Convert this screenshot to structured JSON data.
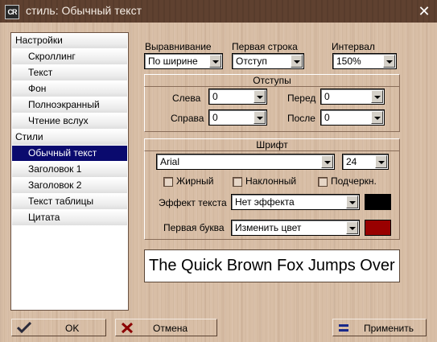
{
  "window": {
    "title": "стиль: Обычный текст",
    "icon_text": "CR"
  },
  "colors": {
    "title_bar": "#5f4130",
    "selection": "#0a0a6e",
    "text_effect_color": "#000000",
    "first_letter_color": "#990000"
  },
  "sidebar": {
    "items": [
      {
        "label": "Настройки",
        "kind": "section"
      },
      {
        "label": "Скроллинг",
        "kind": "item"
      },
      {
        "label": "Текст",
        "kind": "item"
      },
      {
        "label": "Фон",
        "kind": "item"
      },
      {
        "label": "Полноэкранный",
        "kind": "item"
      },
      {
        "label": "Чтение вслух",
        "kind": "item"
      },
      {
        "label": "Стили",
        "kind": "section"
      },
      {
        "label": "Обычный текст",
        "kind": "item",
        "selected": true
      },
      {
        "label": "Заголовок 1",
        "kind": "item"
      },
      {
        "label": "Заголовок 2",
        "kind": "item"
      },
      {
        "label": "Текст таблицы",
        "kind": "item"
      },
      {
        "label": "Цитата",
        "kind": "item"
      }
    ]
  },
  "paragraph": {
    "align_label": "Выравнивание",
    "align_value": "По ширине",
    "first_line_label": "Первая строка",
    "first_line_value": "Отступ",
    "interval_label": "Интервал",
    "interval_value": "150%"
  },
  "indents": {
    "header": "Отступы",
    "left_label": "Слева",
    "left_value": "0",
    "right_label": "Справа",
    "right_value": "0",
    "before_label": "Перед",
    "before_value": "0",
    "after_label": "После",
    "after_value": "0"
  },
  "font": {
    "header": "Шрифт",
    "family_value": "Arial",
    "size_value": "24",
    "bold_label": "Жирный",
    "italic_label": "Наклонный",
    "underline_label": "Подчеркн.",
    "effect_label": "Эффект текста",
    "effect_value": "Нет эффекта",
    "first_letter_label": "Первая буква",
    "first_letter_value": "Изменить цвет"
  },
  "preview": {
    "text": "The Quick Brown Fox Jumps Over the Lazy Dog"
  },
  "buttons": {
    "ok": "OK",
    "cancel": "Отмена",
    "apply": "Применить"
  }
}
